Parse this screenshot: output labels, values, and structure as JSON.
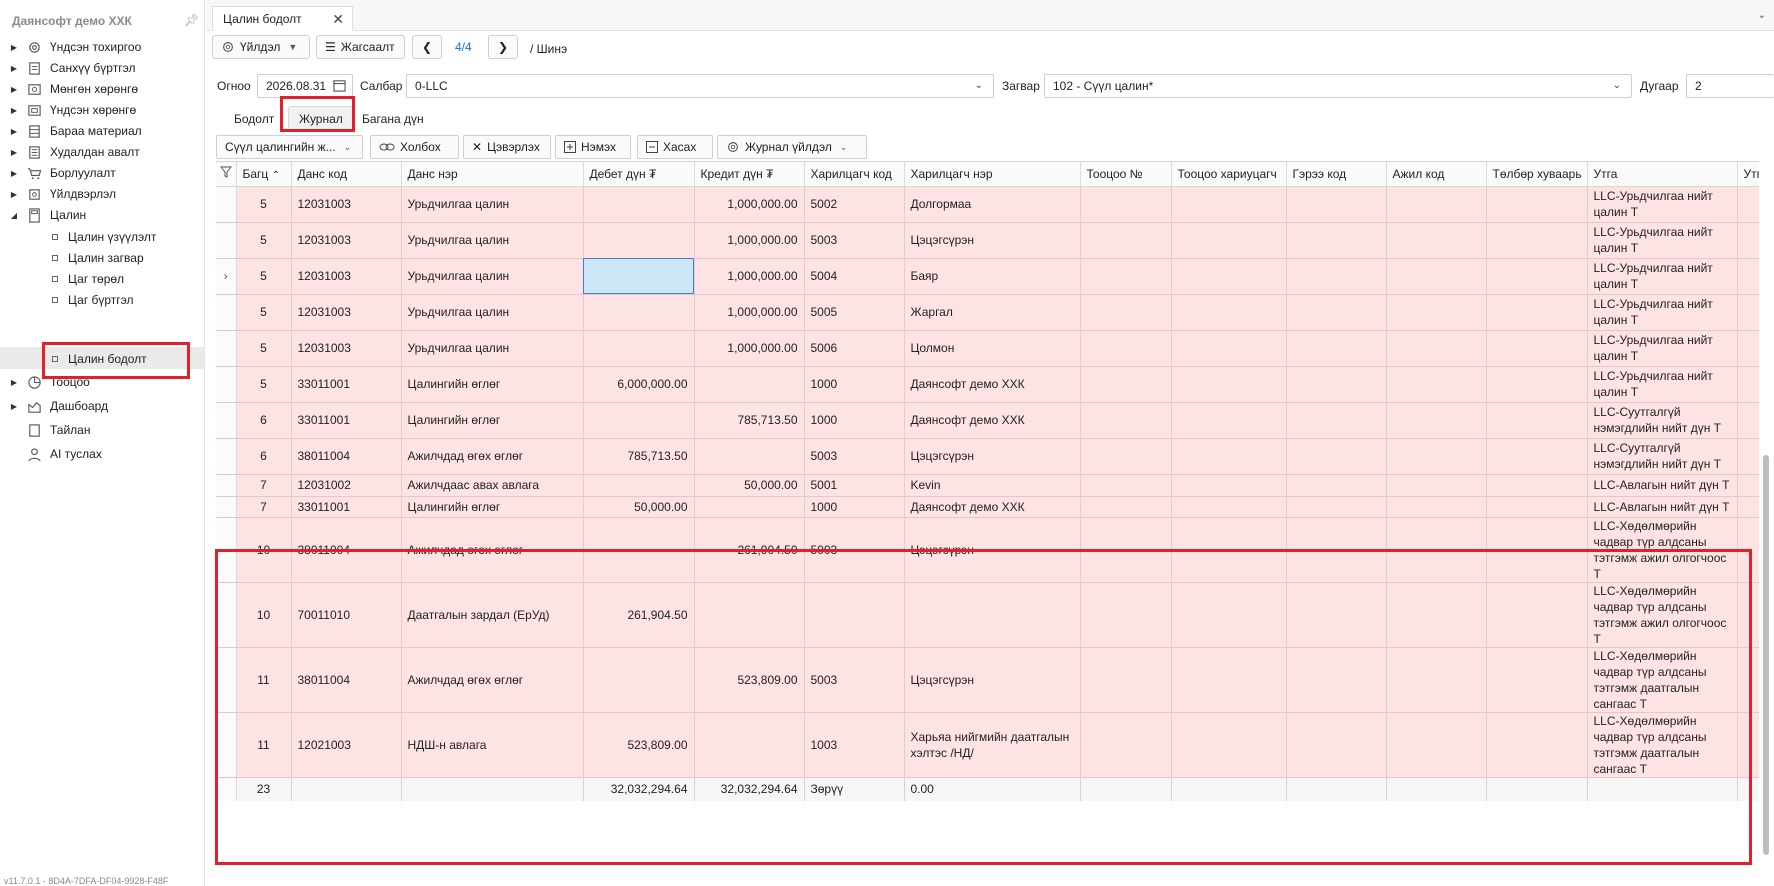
{
  "sidebar": {
    "brand": "Даянсофт демо ХХК",
    "items": [
      {
        "label": "Үндсэн тохиргоо",
        "icon": "gear-icon"
      },
      {
        "label": "Санхүү бүртгэл",
        "icon": "ledger-icon"
      },
      {
        "label": "Мөнгөн хөрөнгө",
        "icon": "cash-icon"
      },
      {
        "label": "Үндсэн хөрөнгө",
        "icon": "asset-icon"
      },
      {
        "label": "Бараа материал",
        "icon": "inventory-icon"
      },
      {
        "label": "Худалдан авалт",
        "icon": "purchase-icon"
      },
      {
        "label": "Борлуулалт",
        "icon": "cart-icon"
      },
      {
        "label": "Үйлдвэрлэл",
        "icon": "factory-icon"
      },
      {
        "label": "Цалин",
        "icon": "payroll-icon"
      },
      {
        "label": "Тооцоо",
        "icon": "pie-chart-icon"
      },
      {
        "label": "Дашбоард",
        "icon": "dashboard-icon"
      },
      {
        "label": "Тайлан",
        "icon": "report-icon"
      },
      {
        "label": "AI туслах",
        "icon": "ai-assistant-icon"
      }
    ],
    "payroll_sub": [
      "Цалин үзүүлэлт",
      "Цалин загвар",
      "Цаг төрөл",
      "Цаг бүртгэл",
      "Цалин бодолт"
    ],
    "version": "v11.7.0.1 - 8D4A-7DFA-DF04-9928-F48F"
  },
  "tab": {
    "title": "Цалин бодолт"
  },
  "toolbar": {
    "actions_label": "Үйлдэл",
    "list_label": "Жагсаалт",
    "pager": "4/4",
    "crumb": "/ Шинэ"
  },
  "form": {
    "date_label": "Огноо",
    "date_value": "2026.08.31",
    "branch_label": "Салбар",
    "branch_value": "0-LLC",
    "template_label": "Загвар",
    "template_value": "102 - Сүүл цалин*",
    "number_label": "Дугаар",
    "number_value": "2"
  },
  "section_tabs": [
    "Бодолт",
    "Журнал",
    "Багана дүн"
  ],
  "grid_toolbar": {
    "filter_value": "Сүүл цалингийн ж...",
    "link_label": "Холбох",
    "clear_label": "Цэвэрлэх",
    "add_label": "Нэмэх",
    "delete_label": "Хасах",
    "journal_actions_label": "Журнал үйлдэл"
  },
  "grid": {
    "columns": [
      "Багц",
      "Данс код",
      "Данс нэр",
      "Дебет дүн ₮",
      "Кредит дүн ₮",
      "Харилцагч код",
      "Харилцагч нэр",
      "Тооцоо №",
      "Тооцоо хариуцагч",
      "Гэрээ код",
      "Ажил код",
      "Төлбөр хуваарь",
      "Утга",
      "Утга"
    ],
    "rows": [
      {
        "batch": "5",
        "acc": "12031003",
        "name": "Урьдчилгаа цалин",
        "debit": "",
        "credit": "1,000,000.00",
        "pcode": "5002",
        "pname": "Долгормаа",
        "memo": "LLC-Урьдчилгаа нийт цалин Т",
        "h": 36
      },
      {
        "batch": "5",
        "acc": "12031003",
        "name": "Урьдчилгаа цалин",
        "debit": "",
        "credit": "1,000,000.00",
        "pcode": "5003",
        "pname": "Цэцэгсүрэн",
        "memo": "LLC-Урьдчилгаа нийт цалин Т",
        "h": 36
      },
      {
        "batch": "5",
        "acc": "12031003",
        "name": "Урьдчилгаа цалин",
        "debit": "",
        "credit": "1,000,000.00",
        "pcode": "5004",
        "pname": "Баяр",
        "memo": "LLC-Урьдчилгаа нийт цалин Т",
        "h": 36,
        "current": true
      },
      {
        "batch": "5",
        "acc": "12031003",
        "name": "Урьдчилгаа цалин",
        "debit": "",
        "credit": "1,000,000.00",
        "pcode": "5005",
        "pname": "Жаргал",
        "memo": "LLC-Урьдчилгаа нийт цалин Т",
        "h": 36
      },
      {
        "batch": "5",
        "acc": "12031003",
        "name": "Урьдчилгаа цалин",
        "debit": "",
        "credit": "1,000,000.00",
        "pcode": "5006",
        "pname": "Цолмон",
        "memo": "LLC-Урьдчилгаа нийт цалин Т",
        "h": 36
      },
      {
        "batch": "5",
        "acc": "33011001",
        "name": "Цалингийн өглөг",
        "debit": "6,000,000.00",
        "credit": "",
        "pcode": "1000",
        "pname": "Даянсофт демо ХХК",
        "memo": "LLC-Урьдчилгаа нийт цалин Т",
        "h": 36
      },
      {
        "batch": "6",
        "acc": "33011001",
        "name": "Цалингийн өглөг",
        "debit": "",
        "credit": "785,713.50",
        "pcode": "1000",
        "pname": "Даянсофт демо ХХК",
        "memo": "LLC-Суутгалгүй нэмэгдлийн нийт дүн Т",
        "h": 36
      },
      {
        "batch": "6",
        "acc": "38011004",
        "name": "Ажилчдад өгөх өглөг",
        "debit": "785,713.50",
        "credit": "",
        "pcode": "5003",
        "pname": "Цэцэгсүрэн",
        "memo": "LLC-Суутгалгүй нэмэгдлийн нийт дүн Т",
        "h": 36
      },
      {
        "batch": "7",
        "acc": "12031002",
        "name": "Ажилчдаас авах авлага",
        "debit": "",
        "credit": "50,000.00",
        "pcode": "5001",
        "pname": "Kevin",
        "memo": "LLC-Авлагын нийт дүн Т",
        "h": 22
      },
      {
        "batch": "7",
        "acc": "33011001",
        "name": "Цалингийн өглөг",
        "debit": "50,000.00",
        "credit": "",
        "pcode": "1000",
        "pname": "Даянсофт демо ХХК",
        "memo": "LLC-Авлагын нийт дүн Т",
        "h": 21,
        "clip": true
      },
      {
        "batch": "10",
        "acc": "38011004",
        "name": "Ажилчдад өгөх өглөг",
        "debit": "",
        "credit": "261,904.50",
        "pcode": "5003",
        "pname": "Цэцэгсүрэн",
        "memo": "LLC-Хөдөлмөрийн чадвар түр алдсаны тэтгэмж ажил олгогчоос Т",
        "h": 65
      },
      {
        "batch": "10",
        "acc": "70011010",
        "name": "Даатгалын зардал (ЕрУд)",
        "debit": "261,904.50",
        "credit": "",
        "pcode": "",
        "pname": "",
        "memo": "LLC-Хөдөлмөрийн чадвар түр алдсаны тэтгэмж ажил олгогчоос Т",
        "h": 65
      },
      {
        "batch": "11",
        "acc": "38011004",
        "name": "Ажилчдад өгөх өглөг",
        "debit": "",
        "credit": "523,809.00",
        "pcode": "5003",
        "pname": "Цэцэгсүрэн",
        "memo": "LLC-Хөдөлмөрийн чадвар түр алдсаны тэтгэмж даатгалын сангаас Т",
        "h": 65
      },
      {
        "batch": "11",
        "acc": "12021003",
        "name": "НДШ-н авлага",
        "debit": "523,809.00",
        "credit": "",
        "pcode": "1003",
        "pname": "Харьяа нийгмийн даатгалын хэлтэс /НД/",
        "memo": "LLC-Хөдөлмөрийн чадвар түр алдсаны тэтгэмж даатгалын сангаас Т",
        "h": 65
      }
    ],
    "footer": {
      "count": "23",
      "debit": "32,032,294.64",
      "credit": "32,032,294.64",
      "diff_label": "Зөрүү",
      "diff_value": "0.00"
    }
  }
}
